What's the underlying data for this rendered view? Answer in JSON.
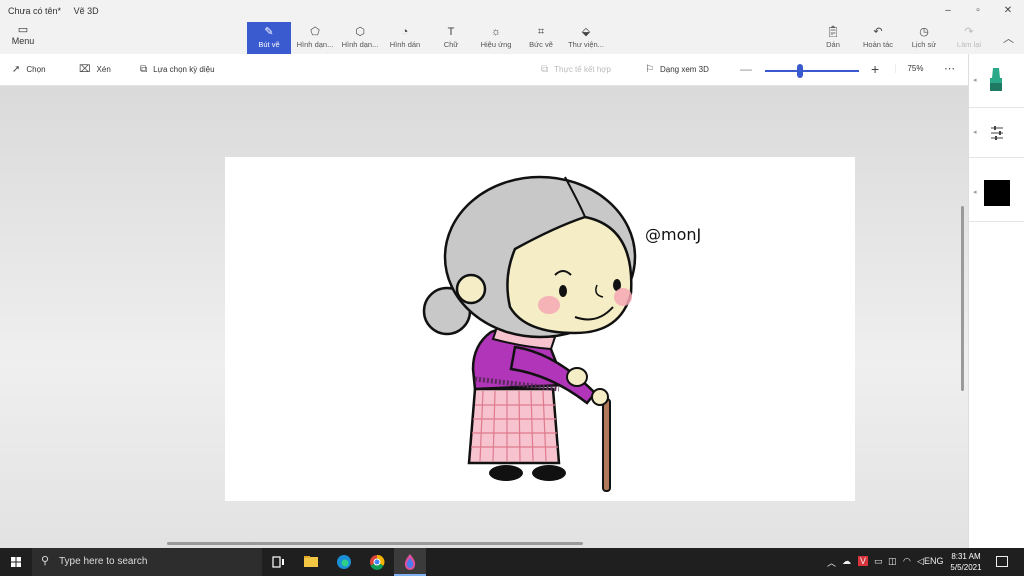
{
  "window": {
    "doc_title": "Chưa có tên*",
    "app_name": "Vẽ 3D"
  },
  "ribbon": {
    "menu_label": "Menu",
    "tools": [
      {
        "label": "Bút vẽ",
        "icon": "brush-icon",
        "active": true
      },
      {
        "label": "Hình dạn...",
        "icon": "2d-shapes-icon"
      },
      {
        "label": "Hình dạn...",
        "icon": "3d-shapes-icon"
      },
      {
        "label": "Hình dán",
        "icon": "stickers-icon"
      },
      {
        "label": "Chữ",
        "icon": "text-icon"
      },
      {
        "label": "Hiệu ứng",
        "icon": "effects-icon"
      },
      {
        "label": "Bức vẽ",
        "icon": "canvas-icon"
      },
      {
        "label": "Thư viện...",
        "icon": "library-icon"
      }
    ],
    "right_tools": [
      {
        "label": "Dán",
        "icon": "paste-icon"
      },
      {
        "label": "Hoàn tác",
        "icon": "undo-icon"
      },
      {
        "label": "Lịch sử",
        "icon": "history-icon"
      },
      {
        "label": "Làm lại",
        "icon": "redo-icon",
        "disabled": true
      }
    ]
  },
  "subbar": {
    "select_label": "Chọn",
    "crop_label": "Xén",
    "magic_select_label": "Lựa chọn kỳ diệu",
    "mixed_reality_label": "Thực tế kết hợp",
    "view3d_label": "Dạng xem 3D",
    "zoom_value": "75%",
    "zoom_fraction": 0.37
  },
  "canvas": {
    "signature_text": "@monJ"
  },
  "right_panel": {
    "selected_color": "#000000",
    "marker_color": "#2aa889"
  },
  "taskbar": {
    "search_placeholder": "Type here to search",
    "language": "ENG",
    "time": "8:31 AM",
    "date": "5/5/2021"
  },
  "colors": {
    "accent": "#3a5bd0",
    "taskbar": "#1f1f1f"
  }
}
